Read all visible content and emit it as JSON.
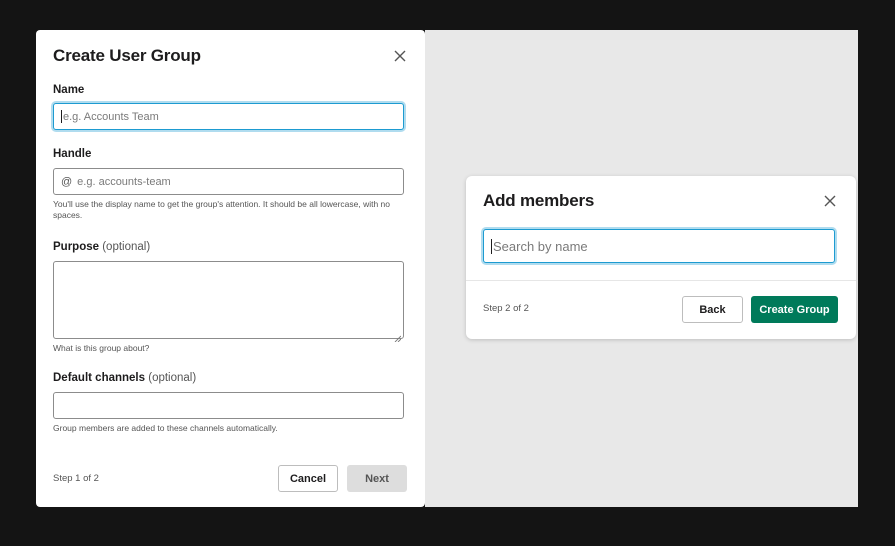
{
  "create_group": {
    "title": "Create User Group",
    "name": {
      "label": "Name",
      "placeholder": "e.g. Accounts Team"
    },
    "handle": {
      "label": "Handle",
      "prefix": "@",
      "placeholder": "e.g. accounts-team",
      "help": "You'll use the display name to get the group's attention. It should be all lowercase, with no spaces."
    },
    "purpose": {
      "label": "Purpose",
      "optional": "(optional)",
      "help": "What is this group about?"
    },
    "channels": {
      "label": "Default channels",
      "optional": "(optional)",
      "help": "Group members are added to these channels automatically."
    },
    "step": "Step 1 of 2",
    "cancel_label": "Cancel",
    "next_label": "Next"
  },
  "add_members": {
    "title": "Add members",
    "search_placeholder": "Search by name",
    "step": "Step 2 of 2",
    "back_label": "Back",
    "create_label": "Create Group"
  },
  "icons": {
    "close": "close-icon",
    "resize": "resize-handle-icon"
  },
  "colors": {
    "primary": "#007a5a",
    "focus": "#1d9bd1",
    "backdrop": "#141414"
  }
}
